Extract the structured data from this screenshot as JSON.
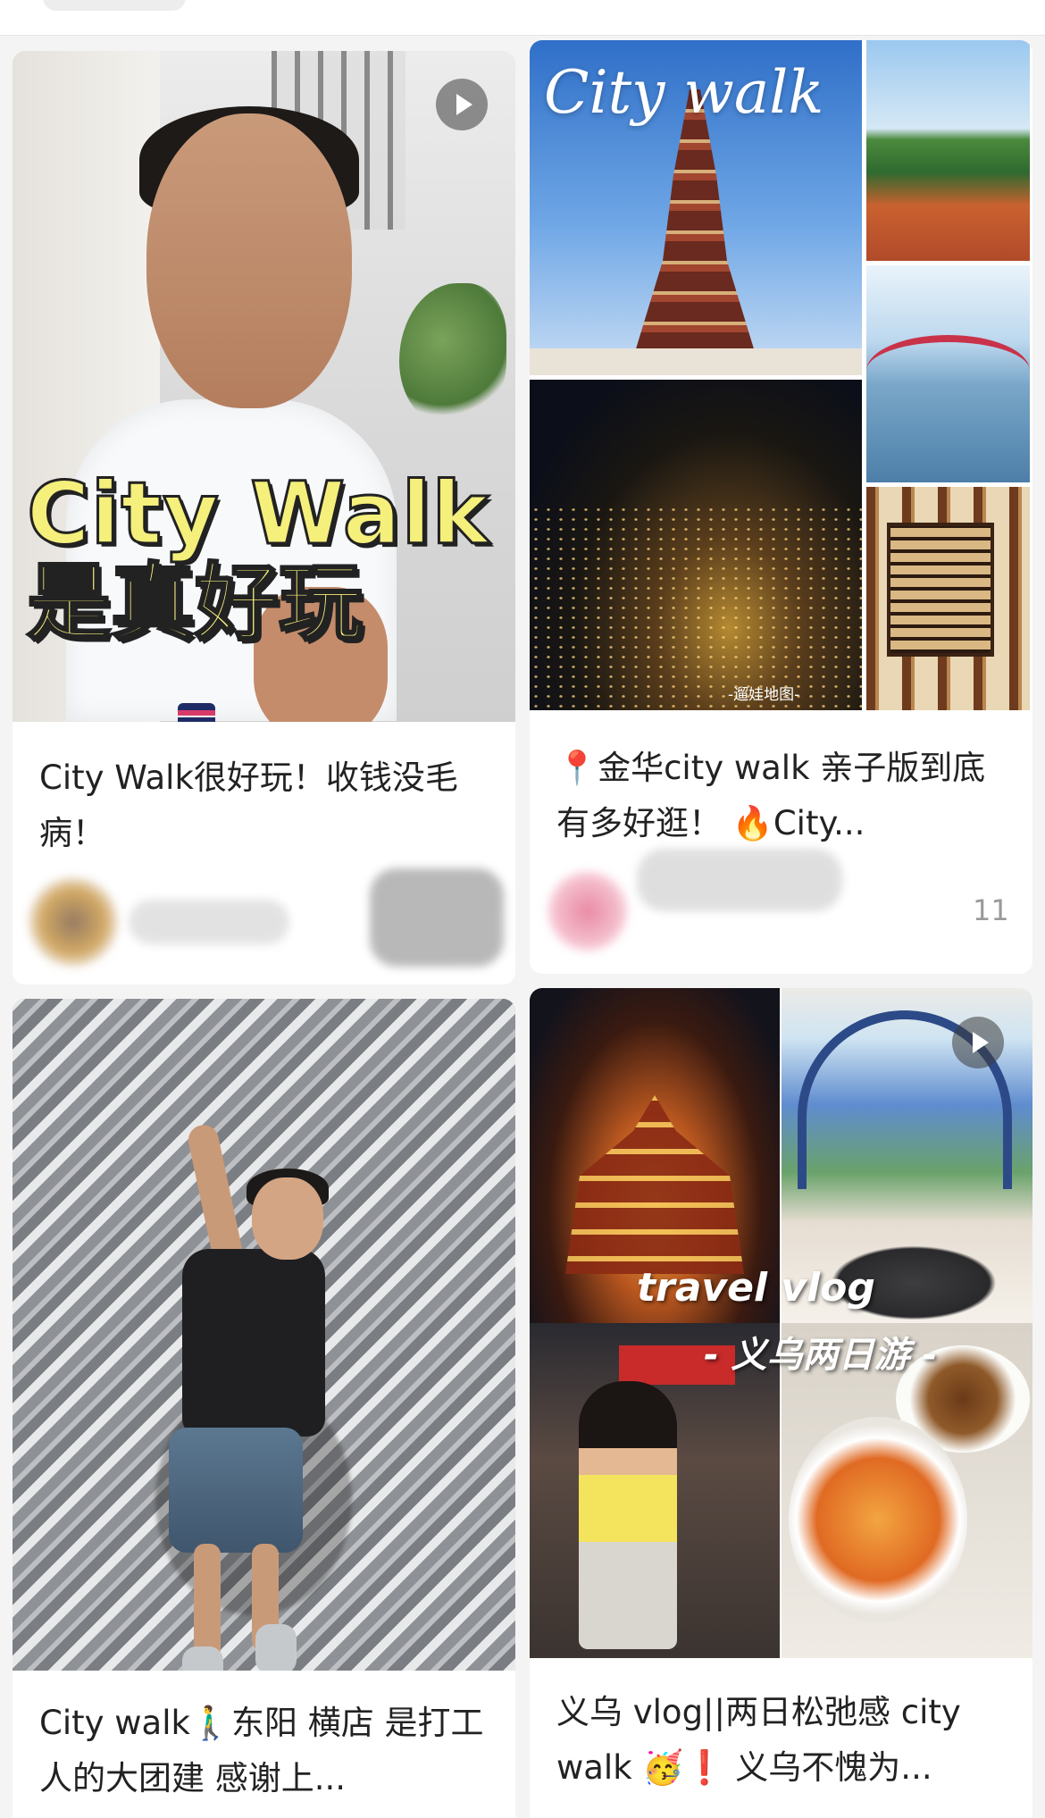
{
  "cards": [
    {
      "title": "City Walk很好玩！收钱没毛病！",
      "overlay_line1": "City Walk",
      "overlay_line2": "是真好玩",
      "has_video": true
    },
    {
      "title": "📍金华city walk 亲子版到底有多好逛！ 🔥City...",
      "overlay_script": "City walk",
      "watermark": "-遛娃地图-",
      "likes": "11",
      "has_video": false
    },
    {
      "title": "City walk🚶‍♂️东阳 横店 是打工人的大团建 感谢上...",
      "has_video": false
    },
    {
      "title": "义乌 vlog||两日松弛感 city walk 🥳❗ 义乌不愧为...",
      "overlay_line1": "travel vlog",
      "overlay_line2": "- 义乌两日游 -",
      "has_video": true
    }
  ],
  "icons": {
    "play": "play-icon"
  }
}
